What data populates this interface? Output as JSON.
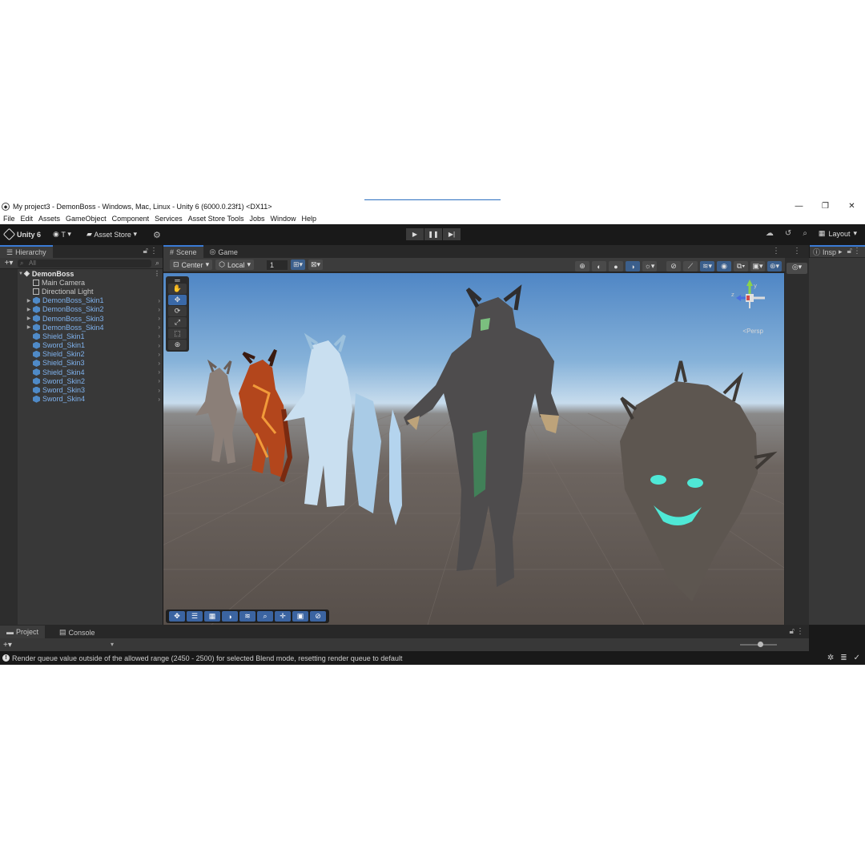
{
  "window": {
    "title": "My project3 - DemonBoss - Windows, Mac, Linux - Unity 6 (6000.0.23f1) <DX11>",
    "minimize": "—",
    "restore": "❐",
    "close": "✕"
  },
  "menu": [
    "File",
    "Edit",
    "Assets",
    "GameObject",
    "Component",
    "Services",
    "Asset Store Tools",
    "Jobs",
    "Window",
    "Help"
  ],
  "toolbar": {
    "unity_label": "Unity 6",
    "account_label": "T",
    "asset_store_label": "Asset Store",
    "layout_label": "Layout"
  },
  "hierarchy": {
    "tab_label": "Hierarchy",
    "search_placeholder": "All",
    "root": "DemonBoss",
    "items": [
      {
        "label": "Main Camera",
        "prefab": false,
        "expandable": false
      },
      {
        "label": "Directional Light",
        "prefab": false,
        "expandable": false
      },
      {
        "label": "DemonBoss_Skin1",
        "prefab": true,
        "expandable": true
      },
      {
        "label": "DemonBoss_Skin2",
        "prefab": true,
        "expandable": true
      },
      {
        "label": "DemonBoss_Skin3",
        "prefab": true,
        "expandable": true
      },
      {
        "label": "DemonBoss_Skin4",
        "prefab": true,
        "expandable": true
      },
      {
        "label": "Shield_Skin1",
        "prefab": true,
        "expandable": false
      },
      {
        "label": "Sword_Skin1",
        "prefab": true,
        "expandable": false
      },
      {
        "label": "Shield_Skin2",
        "prefab": true,
        "expandable": false
      },
      {
        "label": "Shield_Skin3",
        "prefab": true,
        "expandable": false
      },
      {
        "label": "Shield_Skin4",
        "prefab": true,
        "expandable": false
      },
      {
        "label": "Sword_Skin2",
        "prefab": true,
        "expandable": false
      },
      {
        "label": "Sword_Skin3",
        "prefab": true,
        "expandable": false
      },
      {
        "label": "Sword_Skin4",
        "prefab": true,
        "expandable": false
      }
    ]
  },
  "scene": {
    "tabs": [
      "Scene",
      "Game"
    ],
    "pivot_label": "Center",
    "space_label": "Local",
    "grid_value": "1",
    "persp_label": "<Persp",
    "gizmo_axes": {
      "y": "y",
      "x": "x",
      "z": "z"
    }
  },
  "inspector": {
    "tab_label": "Insp"
  },
  "bottom": {
    "tabs": [
      "Project",
      "Console"
    ]
  },
  "status": {
    "message": "Render queue value outside of the allowed range (2450 - 2500) for selected Blend mode, resetting render queue to default"
  },
  "colors": {
    "accent": "#3a7bd5",
    "prefab_text": "#7fb2ee",
    "sky": "#86b2d9",
    "ground": "#5e5650"
  }
}
